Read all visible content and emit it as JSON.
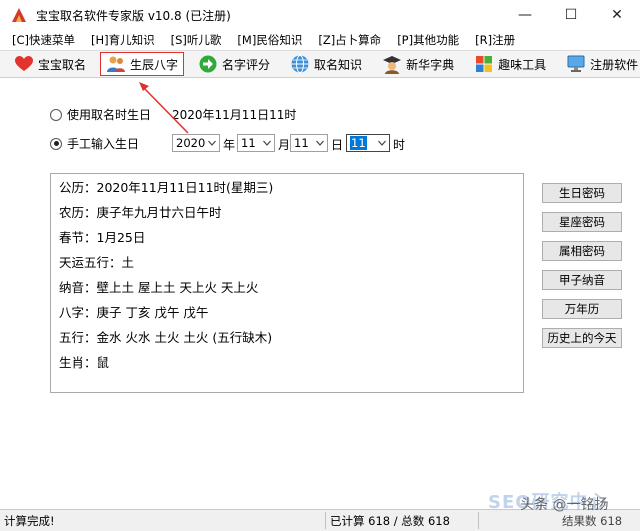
{
  "window": {
    "title": "宝宝取名软件专家版 v10.8 (已注册)",
    "controls": [
      "—",
      "☐",
      "✕"
    ]
  },
  "menu": [
    "[C]快速菜单",
    "[H]育儿知识",
    "[S]听儿歌",
    "[M]民俗知识",
    "[Z]占卜算命",
    "[P]其他功能",
    "[R]注册"
  ],
  "toolbar": [
    {
      "label": "宝宝取名",
      "icon": "heart-icon"
    },
    {
      "label": "生辰八字",
      "icon": "people-icon"
    },
    {
      "label": "名字评分",
      "icon": "arrow-right-icon"
    },
    {
      "label": "取名知识",
      "icon": "globe-icon"
    },
    {
      "label": "新华字典",
      "icon": "graduate-icon"
    },
    {
      "label": "趣味工具",
      "icon": "windows-icon"
    },
    {
      "label": "注册软件",
      "icon": "monitor-icon"
    }
  ],
  "birth": {
    "option_time": "使用取名时生日",
    "option_time_value": "2020年11月11日11时",
    "option_manual": "手工输入生日",
    "year": "2020",
    "year_unit": "年",
    "month": "11",
    "month_unit": "月",
    "day": "11",
    "day_unit": "日",
    "hour": "11",
    "hour_unit": "时"
  },
  "info": [
    "公历：2020年11月11日11时(星期三)",
    "农历：庚子年九月廿六日午时",
    "春节：1月25日",
    "天运五行：土",
    "纳音：壁上土  屋上土  天上火  天上火",
    "八字：庚子  丁亥  戊午  戊午",
    "五行：金水  火水  土火  土火  (五行缺木)",
    "生肖：鼠"
  ],
  "side_buttons": [
    "生日密码",
    "星座密码",
    "属相密码",
    "甲子纳音",
    "万年历",
    "历史上的今天"
  ],
  "status": {
    "left": "计算完成!",
    "middle": "已计算 618 / 总数 618",
    "right": "结果数 618"
  },
  "watermark": {
    "text": "SEO研究中心",
    "overlay": "头条 @一铭扬"
  },
  "colors": {
    "accent": "#e03030",
    "selection": "#0078d7",
    "toolbar_bg": "#f4f4f4"
  }
}
